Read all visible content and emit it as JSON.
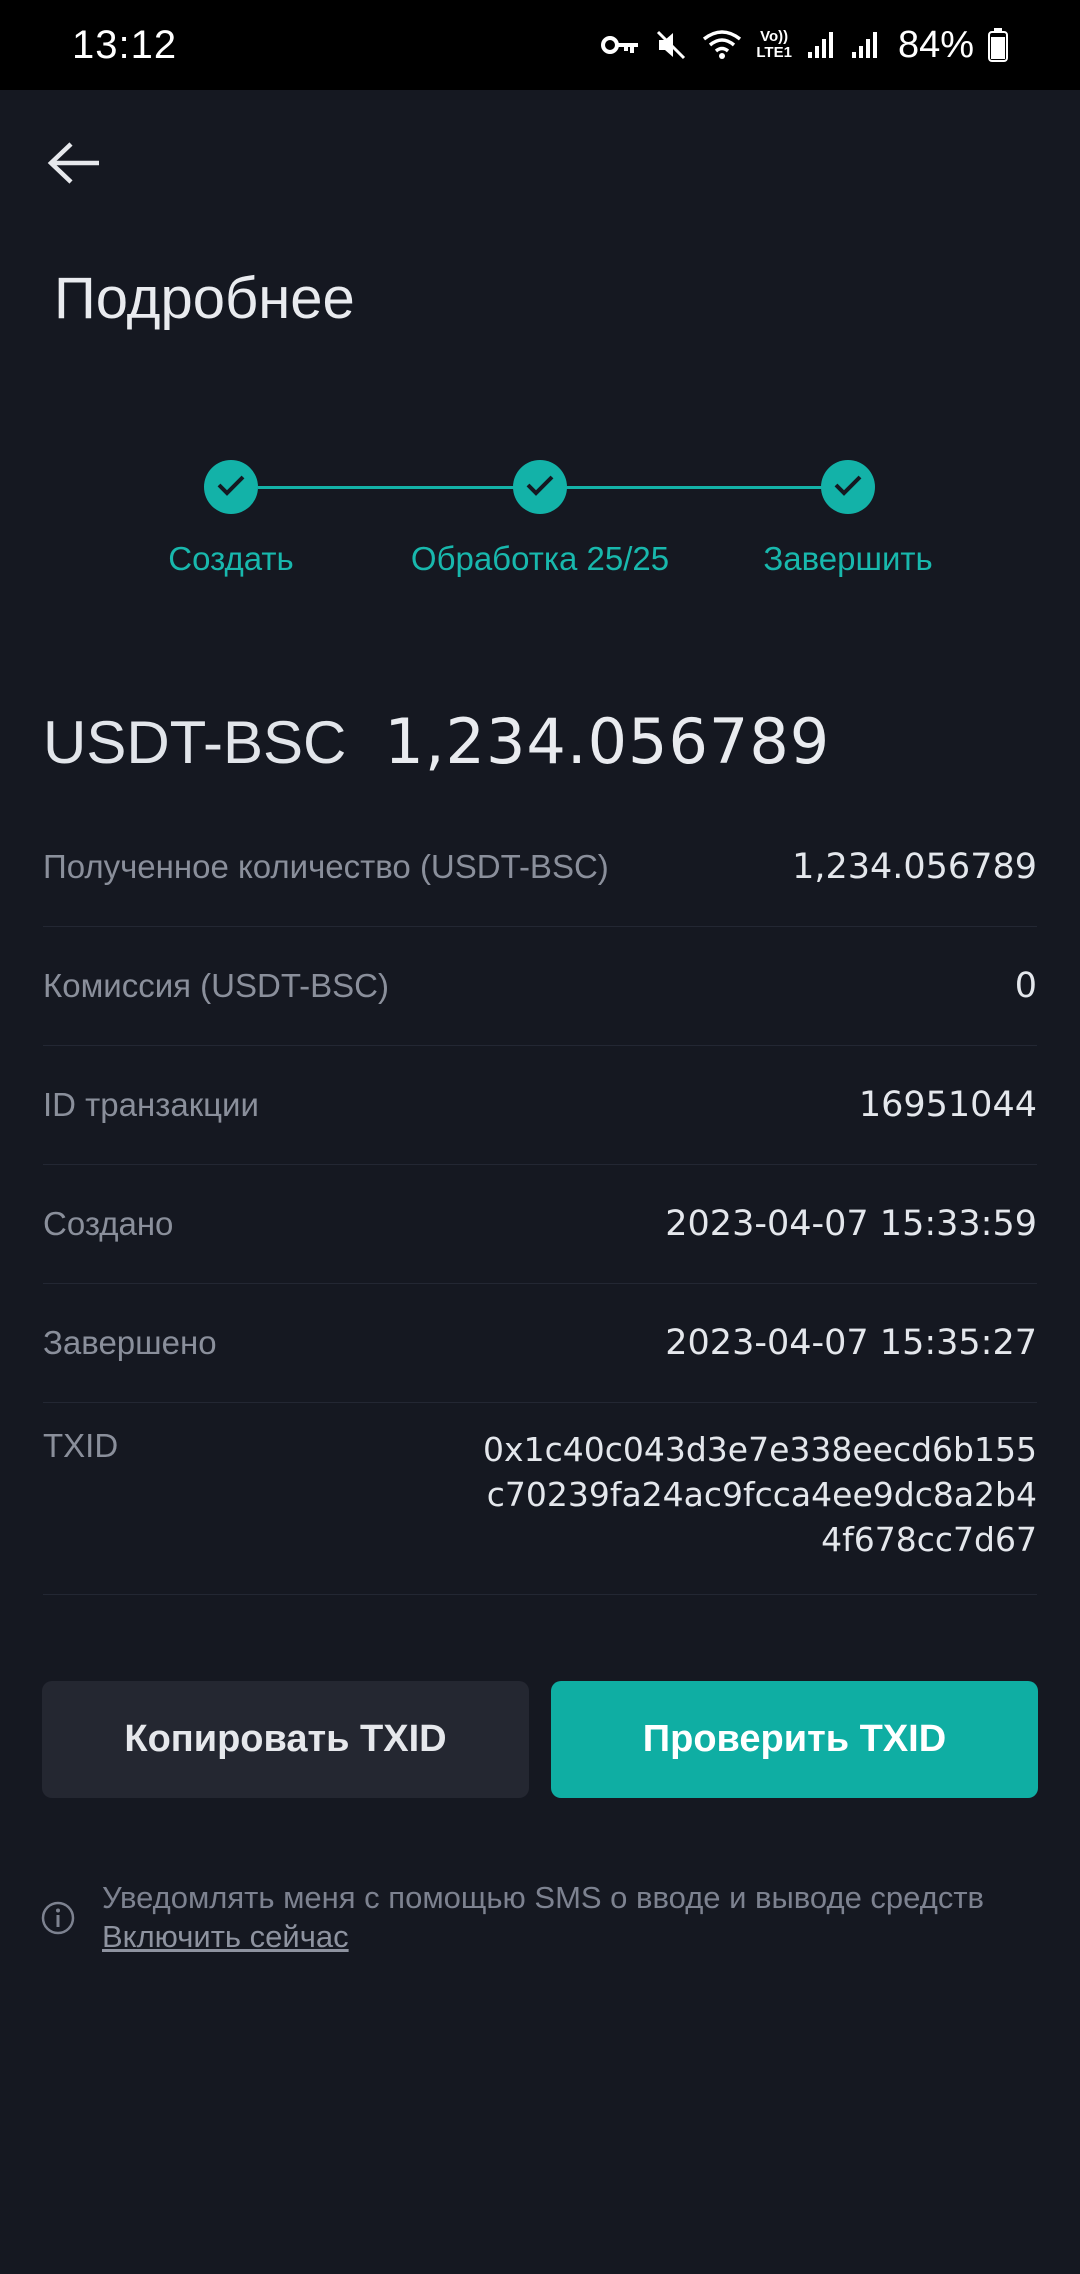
{
  "status_bar": {
    "time": "13:12",
    "battery": "84%",
    "lte_label": "LTE1",
    "volte_label": "Vo))",
    "icons": [
      "key-icon",
      "mute-icon",
      "wifi-icon",
      "signal-icon",
      "signal-icon",
      "battery-icon"
    ]
  },
  "header": {
    "back_icon": "arrow-left-icon",
    "title": "Подробнее"
  },
  "stepper": {
    "steps": [
      {
        "label": "Создать",
        "done": true
      },
      {
        "label": "Обработка 25/25",
        "done": true
      },
      {
        "label": "Завершить",
        "done": true
      }
    ],
    "accent": "#13b2a8"
  },
  "summary": {
    "asset": "USDT-BSC",
    "amount": "1,234.056789"
  },
  "details": [
    {
      "label": "Полученное количество (USDT-BSC)",
      "value": "1,234.056789"
    },
    {
      "label": "Комиссия (USDT-BSC)",
      "value": "0"
    },
    {
      "label": "ID транзакции",
      "value": "16951044"
    },
    {
      "label": "Создано",
      "value": "2023-04-07 15:33:59"
    },
    {
      "label": "Завершено",
      "value": "2023-04-07 15:35:27"
    },
    {
      "label": "TXID",
      "value": "0x1c40c043d3e7e338eecd6b155c70239fa24ac9fcca4ee9dc8a2b44f678cc7d67"
    }
  ],
  "buttons": {
    "copy": "Копировать TXID",
    "check": "Проверить TXID"
  },
  "notice": {
    "icon": "info-icon",
    "text": "Уведомлять меня с помощью SMS о вводе и выводе средств",
    "link": "Включить сейчас"
  },
  "colors": {
    "background": "#151821",
    "accent": "#0faea3",
    "secondary_button": "#242731"
  }
}
